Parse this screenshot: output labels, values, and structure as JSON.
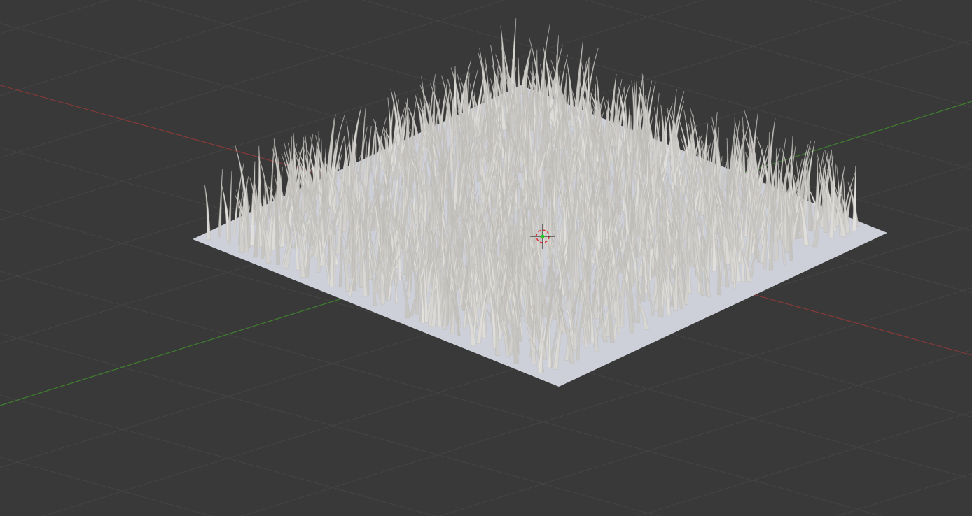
{
  "viewport": {
    "grid": true,
    "cursor": true
  }
}
